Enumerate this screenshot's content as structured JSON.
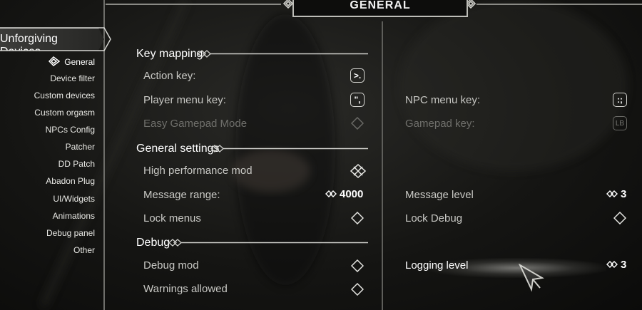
{
  "title": "GENERAL",
  "mod_name": "Unforgiving Devices",
  "pages": [
    {
      "label": "General",
      "current": true
    },
    {
      "label": "Device filter"
    },
    {
      "label": "Custom devices"
    },
    {
      "label": "Custom orgasm"
    },
    {
      "label": "NPCs Config"
    },
    {
      "label": "Patcher"
    },
    {
      "label": "DD Patch"
    },
    {
      "label": "Abadon Plug"
    },
    {
      "label": "UI/Widgets"
    },
    {
      "label": "Animations"
    },
    {
      "label": "Debug panel"
    },
    {
      "label": "Other"
    }
  ],
  "sections": {
    "key_mapping": "Key mapping",
    "general_settings": "General settings",
    "debug": "Debug"
  },
  "options": {
    "action_key": {
      "label": "Action key:",
      "key": ">."
    },
    "player_menu_key": {
      "label": "Player menu key:",
      "key": "\","
    },
    "easy_gamepad_mode": {
      "label": "Easy Gamepad Mode",
      "disabled": true
    },
    "npc_menu_key": {
      "label": "NPC menu key:",
      "key": ":;"
    },
    "gamepad_key": {
      "label": "Gamepad key:",
      "key": "LB",
      "disabled": true
    },
    "high_performance_mod": {
      "label": "High performance mod",
      "checked": true
    },
    "message_range": {
      "label": "Message range:",
      "value": "4000"
    },
    "message_level": {
      "label": "Message level",
      "value": "3"
    },
    "lock_menus": {
      "label": "Lock menus",
      "checked": false
    },
    "lock_debug": {
      "label": "Lock Debug",
      "checked": false
    },
    "debug_mod": {
      "label": "Debug mod",
      "checked": false
    },
    "logging_level": {
      "label": "Logging level",
      "value": "3"
    },
    "warnings_allowed": {
      "label": "Warnings allowed",
      "checked": false
    }
  },
  "icons": {
    "knot": "celtic-knot-icon",
    "cursor": "arrow-cursor-icon",
    "toggle_off": "diamond-empty-icon",
    "toggle_on": "knot-checked-icon",
    "slider": "slider-arrows-icon"
  }
}
